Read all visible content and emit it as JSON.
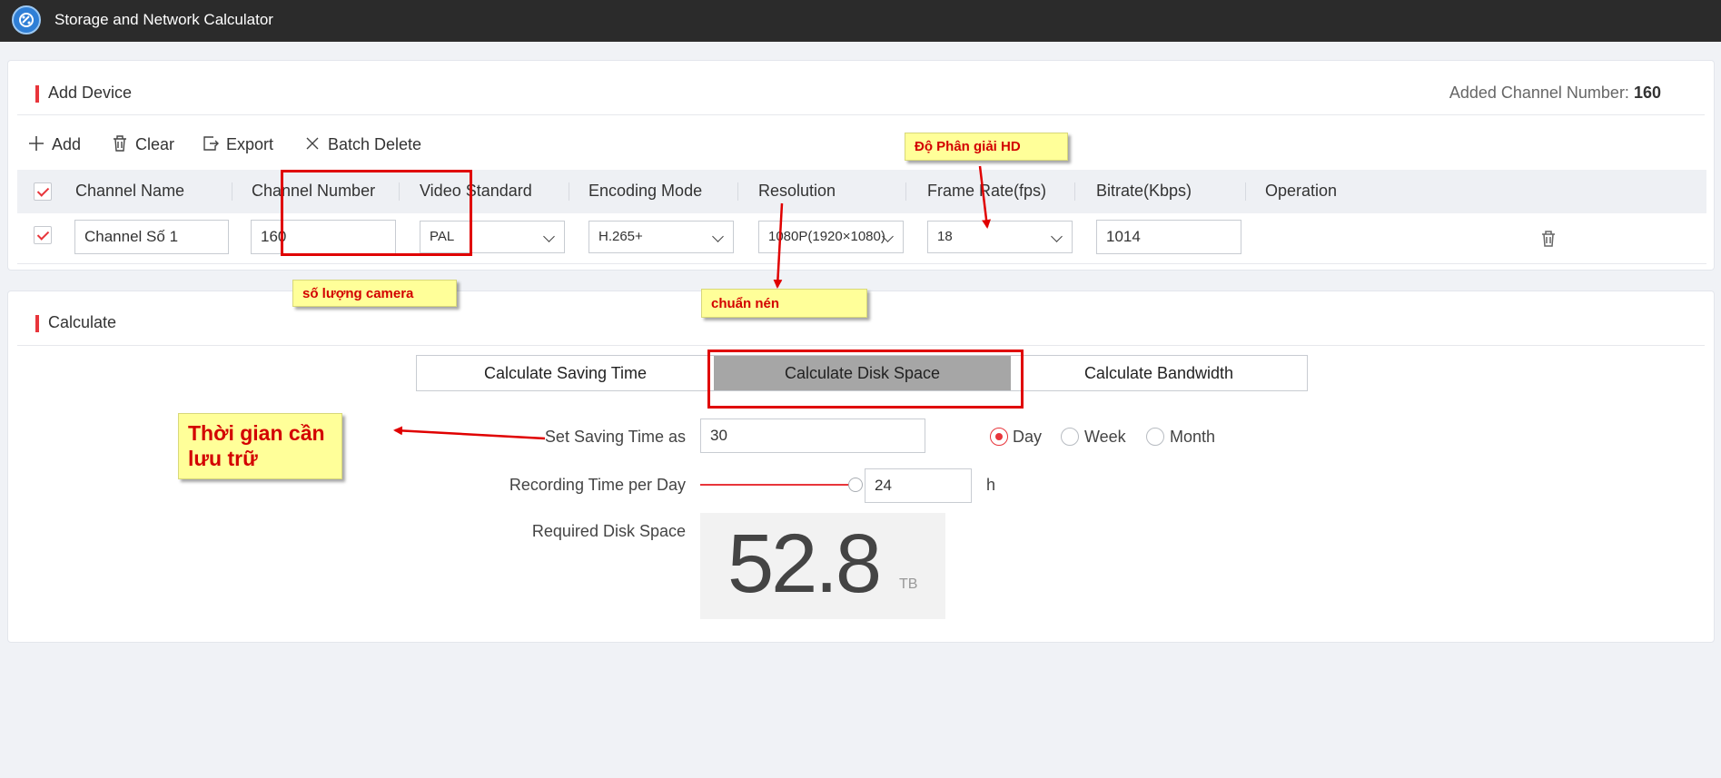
{
  "window": {
    "title": "Storage and Network Calculator"
  },
  "add_device": {
    "title": "Add Device",
    "added_label": "Added Channel Number:",
    "added_value": "160",
    "toolbar": {
      "add": "Add",
      "clear": "Clear",
      "export": "Export",
      "batch_delete": "Batch Delete"
    },
    "columns": [
      "Channel Name",
      "Channel Number",
      "Video Standard",
      "Encoding Mode",
      "Resolution",
      "Frame Rate(fps)",
      "Bitrate(Kbps)",
      "Operation"
    ],
    "row": {
      "channel_name": "Channel Số 1",
      "channel_number": "160",
      "video_standard": "PAL",
      "encoding_mode": "H.265+",
      "resolution": "1080P(1920×1080)",
      "frame_rate": "18",
      "bitrate": "1014"
    }
  },
  "calculate": {
    "title": "Calculate",
    "tabs": [
      "Calculate Saving Time",
      "Calculate Disk Space",
      "Calculate Bandwidth"
    ],
    "active_tab": "Calculate Disk Space",
    "saving_time_label": "Set Saving Time as",
    "saving_time_value": "30",
    "units": [
      "Day",
      "Week",
      "Month"
    ],
    "selected_unit": "Day",
    "recording_label": "Recording Time per Day",
    "recording_value": "24",
    "recording_unit": "h",
    "recording_fraction": 1.0,
    "required_label": "Required Disk Space",
    "required_value": "52.8",
    "required_unit": "TB"
  },
  "annotations": {
    "resolution_note": "Độ Phân giải HD",
    "camera_count_note": "số lượng camera",
    "encoding_note": "chuẩn nén",
    "saving_time_note": "Thời gian cần lưu trữ"
  },
  "colors": {
    "accent": "#e8353b",
    "titlebar": "#2b2b2b",
    "note_bg": "#ffff99",
    "note_text": "#d30000",
    "active_tab": "#a6a6a6"
  }
}
